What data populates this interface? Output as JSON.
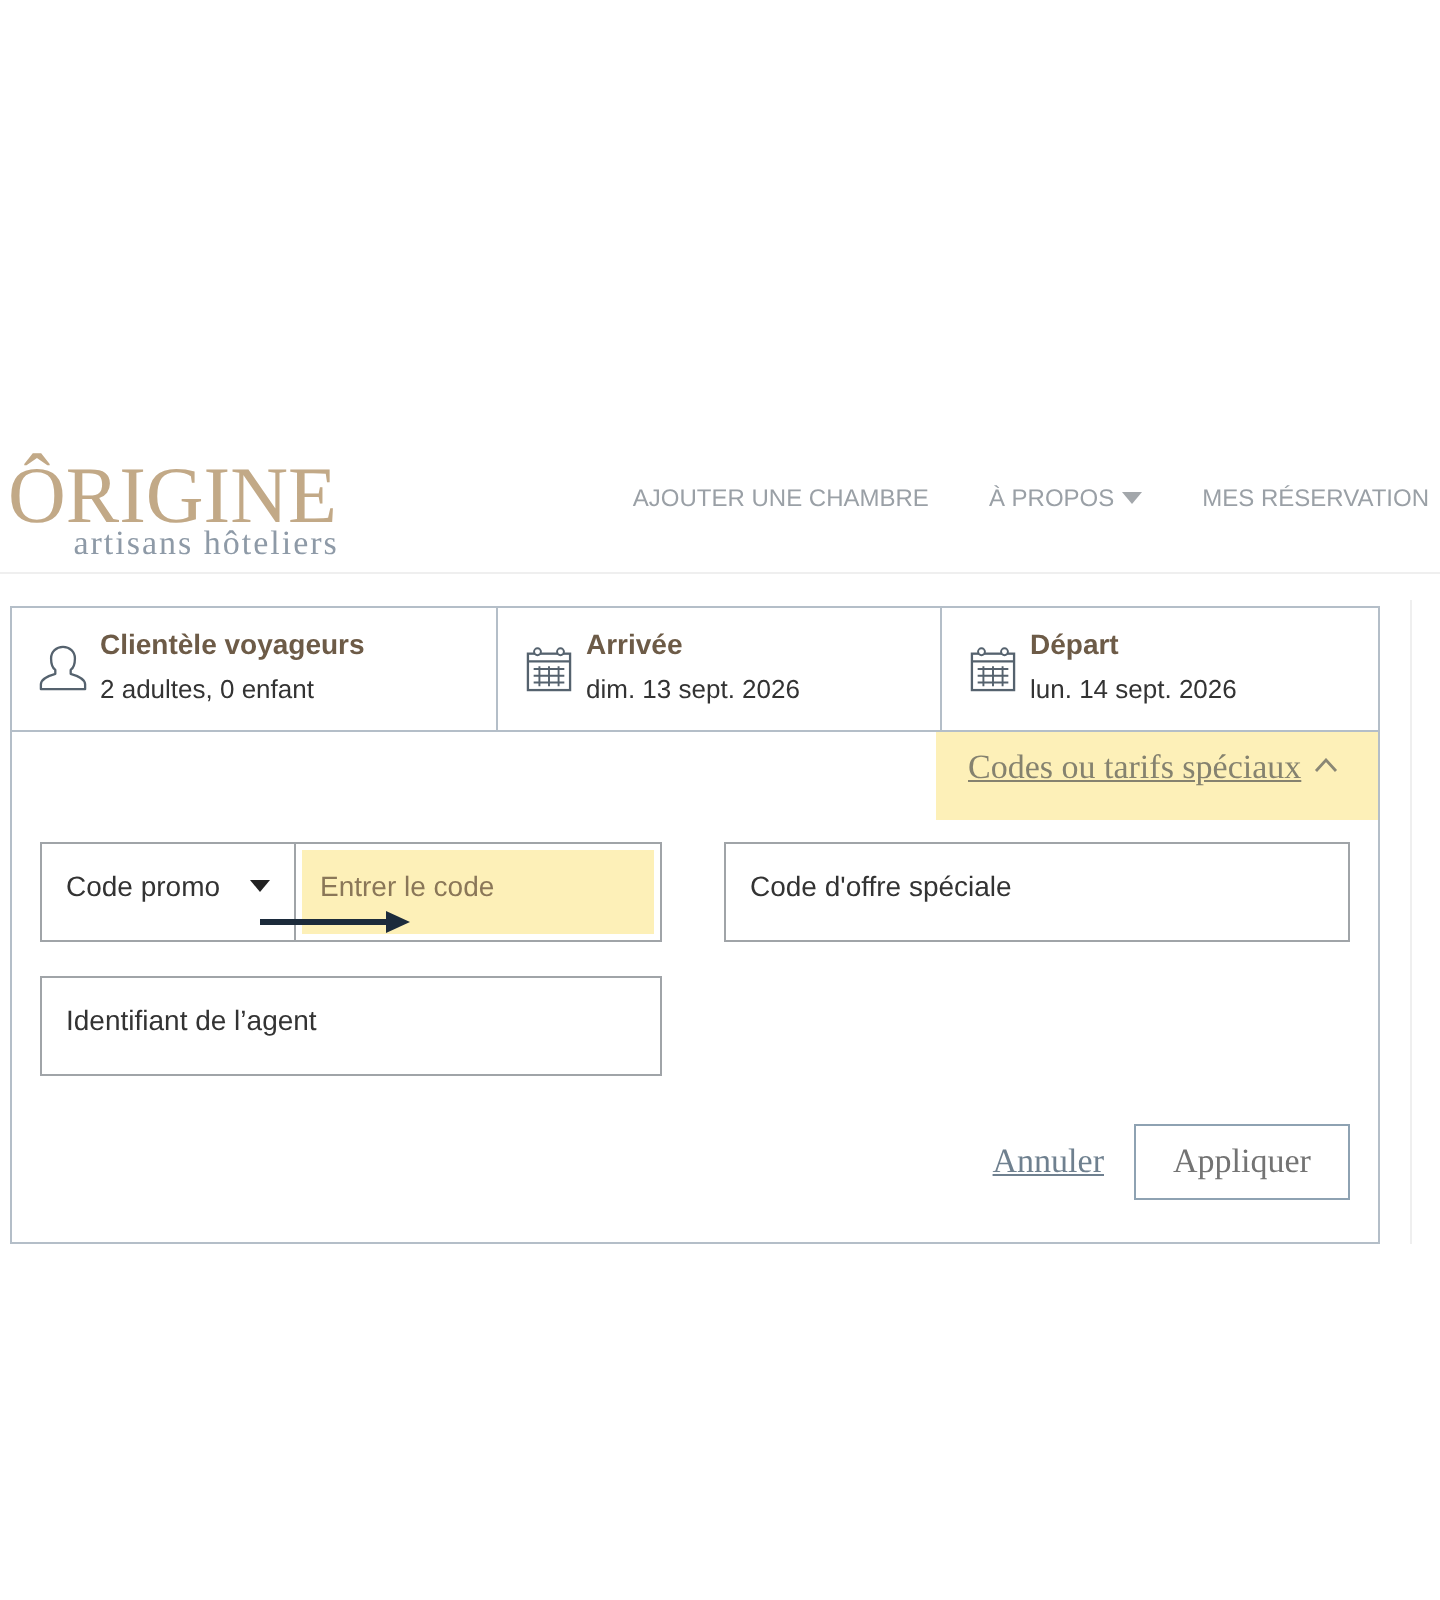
{
  "header": {
    "logo": {
      "name": "ÔRIGINE",
      "tagline": "artisans hôteliers"
    },
    "nav": [
      {
        "label": "AJOUTER UNE CHAMBRE",
        "kind": "link"
      },
      {
        "label": "À PROPOS",
        "kind": "dropdown"
      },
      {
        "label": "MES RÉSERVATION",
        "kind": "link"
      }
    ]
  },
  "booking": {
    "summary": [
      {
        "kind": "guests",
        "title": "Clientèle voyageurs",
        "value": "2 adultes, 0 enfant"
      },
      {
        "kind": "date",
        "title": "Arrivée",
        "value": "dim. 13 sept. 2026"
      },
      {
        "kind": "date",
        "title": "Départ",
        "value": "lun. 14 sept. 2026"
      }
    ],
    "special_codes": {
      "label": "Codes ou tarifs spéciaux",
      "expanded": true,
      "highlighted": true,
      "code_type": {
        "value": "Code promo"
      },
      "code_input": {
        "placeholder": "Entrer le code",
        "highlighted": true
      },
      "offer_field": {
        "placeholder": "Code d'offre spéciale"
      },
      "agent_field": {
        "placeholder": "Identifiant de l’agent"
      },
      "cancel_label": "Annuler",
      "apply_label": "Appliquer"
    }
  }
}
